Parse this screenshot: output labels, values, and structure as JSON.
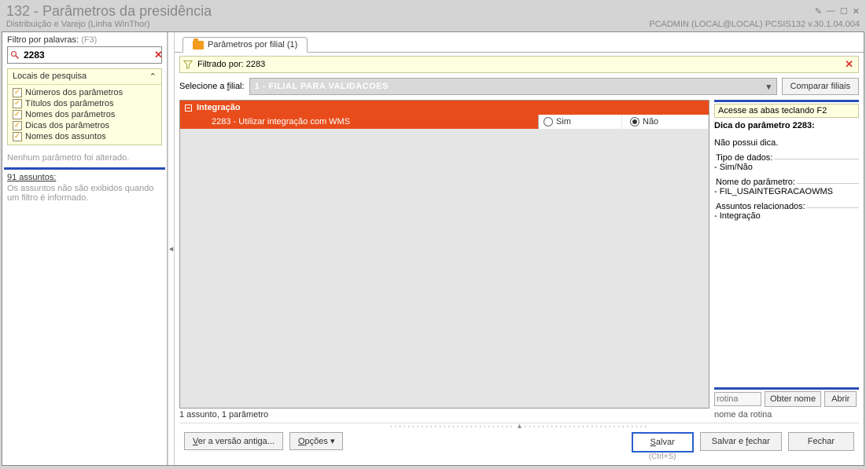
{
  "title": "132 - Parâmetros da presidência",
  "subtitle_left": "Distribuição e Varejo (Linha WinThor)",
  "subtitle_right": "PCADMIN (LOCAL@LOCAL)   PCSIS132  v.30.1.04.004",
  "left": {
    "filter_label": "Filtro por palavras:",
    "filter_hint": "(F3)",
    "filter_value": "2283",
    "locais": {
      "header": "Locais de pesquisa",
      "collapse": "«",
      "items": [
        "Números dos parâmetros",
        "Títulos dos parâmetros",
        "Nomes dos parâmetros",
        "Dicas dos parâmetros",
        "Nomes dos assuntos"
      ]
    },
    "status": "Nenhum parâmetro foi alterado.",
    "subjects_header": "91 assuntos:",
    "subjects_info": "Os assuntos não são exibidos quando um filtro é informado."
  },
  "tab": {
    "label": "Parâmetros por filial  (1)"
  },
  "filtered_by_label": "Filtrado por:",
  "filtered_by_value": "2283",
  "filial_label": "Selecione a filial:",
  "filial_value": "1 - FILIAL PARA VALIDACOES",
  "compare_btn": "Comparar filiais",
  "grid": {
    "group": "Integração",
    "row_label": "2283 - Utilizar integração com WMS",
    "opt_sim": "Sim",
    "opt_nao": "Não"
  },
  "info": {
    "f2": "Acesse as abas teclando F2",
    "hint_title": "Dica do parâmetro 2283:",
    "hint_text": "Não possui dica.",
    "tipo_legend": "Tipo de dados:",
    "tipo_val": "- Sim/Não",
    "nome_legend": "Nome do parâmetro:",
    "nome_val": "- FIL_USAINTEGRACAOWMS",
    "ass_legend": "Assuntos relacionados:",
    "ass_val": "- Integração"
  },
  "rotina": {
    "placeholder": "rotina",
    "obter": "Obter nome",
    "abrir": "Abrir",
    "caption": "nome da rotina"
  },
  "under_grid": "1 assunto, 1 parâmetro",
  "footer": {
    "versao": "Ver a versão antiga...",
    "opcoes": "Opções ▾",
    "salvar": "Salvar",
    "salvar_fechar": "Salvar e fechar",
    "fechar": "Fechar",
    "shortcut": "(Ctrl+S)"
  }
}
